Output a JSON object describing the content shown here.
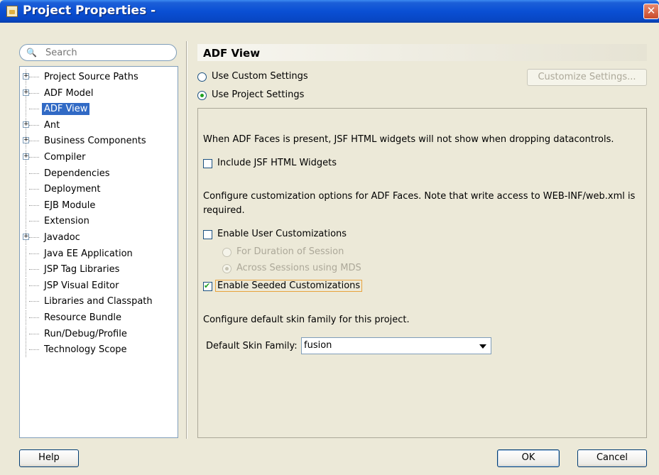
{
  "window": {
    "title": "Project Properties -"
  },
  "search": {
    "placeholder": "Search"
  },
  "tree": {
    "items": [
      {
        "label": "Project Source Paths",
        "expandable": true,
        "selected": false
      },
      {
        "label": "ADF Model",
        "expandable": true,
        "selected": false
      },
      {
        "label": "ADF View",
        "expandable": false,
        "selected": true
      },
      {
        "label": "Ant",
        "expandable": true,
        "selected": false
      },
      {
        "label": "Business Components",
        "expandable": true,
        "selected": false
      },
      {
        "label": "Compiler",
        "expandable": true,
        "selected": false
      },
      {
        "label": "Dependencies",
        "expandable": false,
        "selected": false
      },
      {
        "label": "Deployment",
        "expandable": false,
        "selected": false
      },
      {
        "label": "EJB Module",
        "expandable": false,
        "selected": false
      },
      {
        "label": "Extension",
        "expandable": false,
        "selected": false
      },
      {
        "label": "Javadoc",
        "expandable": true,
        "selected": false
      },
      {
        "label": "Java EE Application",
        "expandable": false,
        "selected": false
      },
      {
        "label": "JSP Tag Libraries",
        "expandable": false,
        "selected": false
      },
      {
        "label": "JSP Visual Editor",
        "expandable": false,
        "selected": false
      },
      {
        "label": "Libraries and Classpath",
        "expandable": false,
        "selected": false
      },
      {
        "label": "Resource Bundle",
        "expandable": false,
        "selected": false
      },
      {
        "label": "Run/Debug/Profile",
        "expandable": false,
        "selected": false
      },
      {
        "label": "Technology Scope",
        "expandable": false,
        "selected": false
      }
    ]
  },
  "main": {
    "title": "ADF View",
    "use_custom_settings": "Use Custom Settings",
    "use_project_settings": "Use Project Settings",
    "customize_settings_button": "Customize Settings...",
    "jsf_note": "When ADF Faces is present, JSF HTML widgets will not show when dropping datacontrols.",
    "include_jsf_widgets": "Include JSF HTML Widgets",
    "customization_note_line1": "Configure customization options for ADF Faces. Note that write access to WEB-INF/web.xml is",
    "customization_note_line2": "required.",
    "enable_user_customizations": "Enable User Customizations",
    "for_duration_of_session": "For Duration of Session",
    "across_sessions_mds": "Across Sessions using MDS",
    "enable_seeded_customizations": "Enable Seeded Customizations",
    "skin_note": "Configure default skin family for this project.",
    "default_skin_family_label": "Default Skin Family:",
    "default_skin_family_value": "fusion"
  },
  "buttons": {
    "help": "Help",
    "ok": "OK",
    "cancel": "Cancel"
  },
  "icons": {
    "search": "binoculars-icon",
    "window": "app-icon",
    "close": "close-icon"
  },
  "colors": {
    "titlebar": "#0a4fd4",
    "selection": "#316ac5",
    "dialog_bg": "#ece9d8"
  }
}
